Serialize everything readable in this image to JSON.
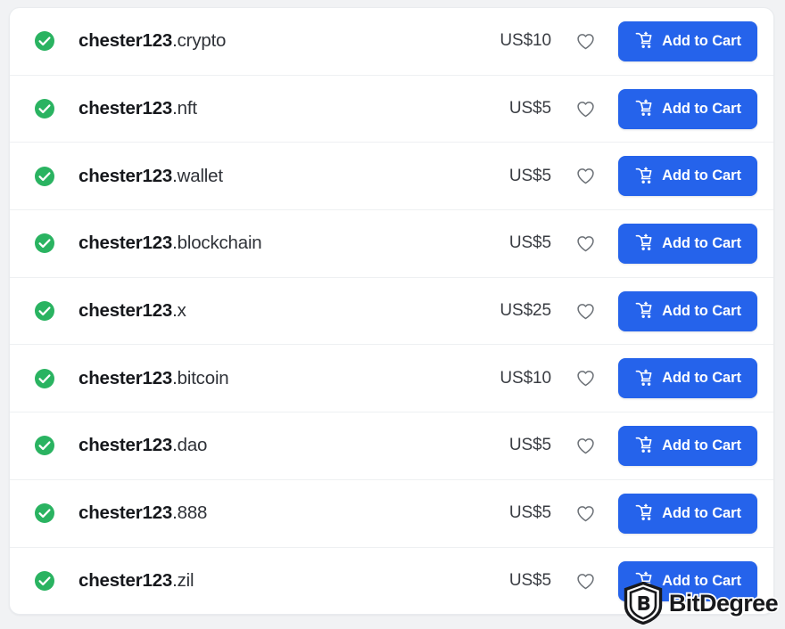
{
  "colors": {
    "page_background": "#f1f2f4",
    "card_background": "#ffffff",
    "available_check": "#2ab361",
    "cart_button": "#2563eb",
    "divider": "#eef0f2",
    "price_text": "#3a3d43",
    "domain_text": "#16181c"
  },
  "search_results": {
    "rows": [
      {
        "status_icon": "check-circle-icon",
        "status": "available",
        "sld": "chester123",
        "tld": ".crypto",
        "price": "US$10",
        "favorite_icon": "heart-outline-icon",
        "cart_icon": "cart-plus-icon",
        "cart_label": "Add to Cart"
      },
      {
        "status_icon": "check-circle-icon",
        "status": "available",
        "sld": "chester123",
        "tld": ".nft",
        "price": "US$5",
        "favorite_icon": "heart-outline-icon",
        "cart_icon": "cart-plus-icon",
        "cart_label": "Add to Cart"
      },
      {
        "status_icon": "check-circle-icon",
        "status": "available",
        "sld": "chester123",
        "tld": ".wallet",
        "price": "US$5",
        "favorite_icon": "heart-outline-icon",
        "cart_icon": "cart-plus-icon",
        "cart_label": "Add to Cart"
      },
      {
        "status_icon": "check-circle-icon",
        "status": "available",
        "sld": "chester123",
        "tld": ".blockchain",
        "price": "US$5",
        "favorite_icon": "heart-outline-icon",
        "cart_icon": "cart-plus-icon",
        "cart_label": "Add to Cart"
      },
      {
        "status_icon": "check-circle-icon",
        "status": "available",
        "sld": "chester123",
        "tld": ".x",
        "price": "US$25",
        "favorite_icon": "heart-outline-icon",
        "cart_icon": "cart-plus-icon",
        "cart_label": "Add to Cart"
      },
      {
        "status_icon": "check-circle-icon",
        "status": "available",
        "sld": "chester123",
        "tld": ".bitcoin",
        "price": "US$10",
        "favorite_icon": "heart-outline-icon",
        "cart_icon": "cart-plus-icon",
        "cart_label": "Add to Cart"
      },
      {
        "status_icon": "check-circle-icon",
        "status": "available",
        "sld": "chester123",
        "tld": ".dao",
        "price": "US$5",
        "favorite_icon": "heart-outline-icon",
        "cart_icon": "cart-plus-icon",
        "cart_label": "Add to Cart"
      },
      {
        "status_icon": "check-circle-icon",
        "status": "available",
        "sld": "chester123",
        "tld": ".888",
        "price": "US$5",
        "favorite_icon": "heart-outline-icon",
        "cart_icon": "cart-plus-icon",
        "cart_label": "Add to Cart"
      },
      {
        "status_icon": "check-circle-icon",
        "status": "available",
        "sld": "chester123",
        "tld": ".zil",
        "price": "US$5",
        "favorite_icon": "heart-outline-icon",
        "cart_icon": "cart-plus-icon",
        "cart_label": "Add to Cart"
      }
    ]
  },
  "watermark": {
    "logo_icon": "bitdegree-shield-icon",
    "text": "BitDegree"
  }
}
